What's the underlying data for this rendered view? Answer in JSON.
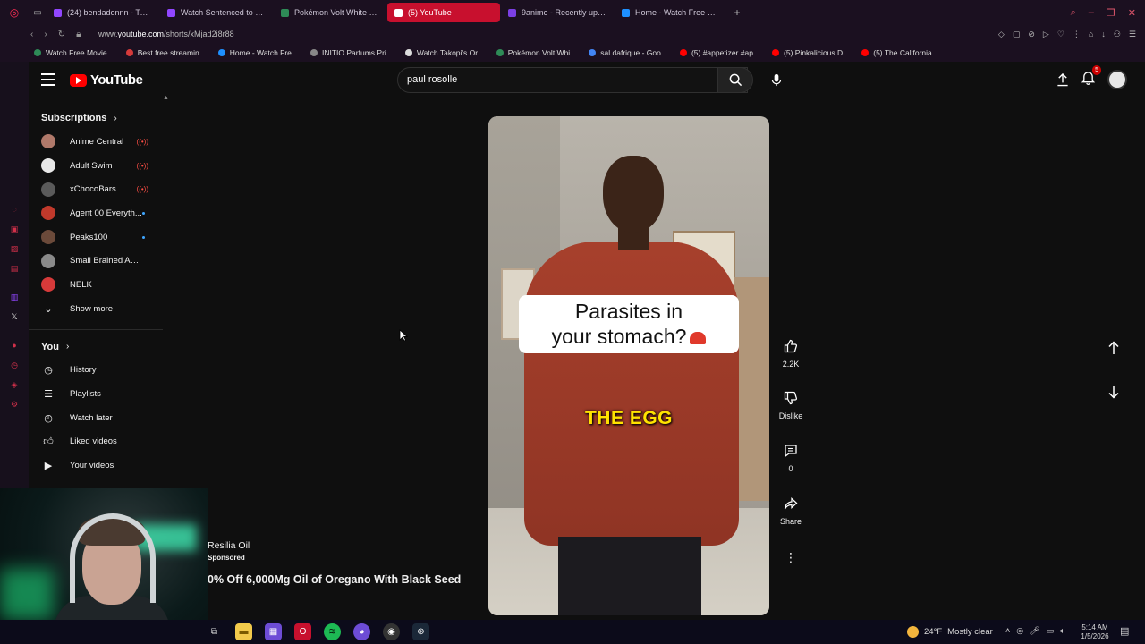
{
  "browser": {
    "tabs": [
      {
        "label": "(24) bendadonnn - Twitch",
        "color": "#9146ff"
      },
      {
        "label": "Watch Sentenced to Be a Hero",
        "color": "#9146ff"
      },
      {
        "label": "Pokémon Volt White 2 Redux",
        "color": "#2e8b57"
      },
      {
        "label": "(5) YouTube",
        "color": "#ff0000",
        "active": true
      },
      {
        "label": "9anime - Recently updated",
        "color": "#7b3fe4"
      },
      {
        "label": "Home - Watch Free Movies",
        "color": "#1e90ff"
      }
    ],
    "url_prefix": "www.",
    "url_domain": "youtube.com",
    "url_path": "/shorts/xMjad2i8r88",
    "bookmarks": [
      {
        "label": "Watch Free Movie...",
        "color": "#2e8b57"
      },
      {
        "label": "Best free streamin...",
        "color": "#d63a3a"
      },
      {
        "label": "Home - Watch Fre...",
        "color": "#1e90ff"
      },
      {
        "label": "INITIO Parfums Pri...",
        "color": "#888888"
      },
      {
        "label": "Watch Takopi's Or...",
        "color": "#dddddd"
      },
      {
        "label": "Pokémon Volt Whi...",
        "color": "#2e8b57"
      },
      {
        "label": "sal dafrique - Goo...",
        "color": "#4285f4"
      },
      {
        "label": "(5) #appetizer #ap...",
        "color": "#ff0000"
      },
      {
        "label": "(5) Pinkalicious D...",
        "color": "#ff0000"
      },
      {
        "label": "(5) The California...",
        "color": "#ff0000"
      }
    ]
  },
  "youtube": {
    "logo_text": "YouTube",
    "search_value": "paul rosolle",
    "notification_count": "5",
    "sidebar": {
      "subscriptions_label": "Subscriptions",
      "subscriptions": [
        {
          "label": "Anime Central",
          "color": "#b0796a",
          "status": "live"
        },
        {
          "label": "Adult Swim",
          "color": "#e8e8e8",
          "status": "live"
        },
        {
          "label": "xChocoBars",
          "color": "#5a5a5a",
          "status": "live"
        },
        {
          "label": "Agent 00 Everyth...",
          "color": "#c0392b",
          "status": "dot"
        },
        {
          "label": "Peaks100",
          "color": "#6b4a3a",
          "status": "dot"
        },
        {
          "label": "Small Brained Ame...",
          "color": "#8a8a8a",
          "status": "none"
        },
        {
          "label": "NELK",
          "color": "#d63a3a",
          "status": "none"
        }
      ],
      "show_more_label": "Show more",
      "you_label": "You",
      "you_items": [
        {
          "label": "History",
          "icon": "history-icon"
        },
        {
          "label": "Playlists",
          "icon": "playlists-icon"
        },
        {
          "label": "Watch later",
          "icon": "watch-later-icon"
        },
        {
          "label": "Liked videos",
          "icon": "liked-videos-icon"
        },
        {
          "label": "Your videos",
          "icon": "your-videos-icon"
        }
      ]
    },
    "short": {
      "caption_line1": "Parasites in",
      "caption_line2": "your stomach?",
      "subtitle": "THE EGG"
    },
    "actions": {
      "like_count": "2.2K",
      "dislike_label": "Dislike",
      "comment_count": "0",
      "share_label": "Share"
    },
    "ad": {
      "advertiser": "Resilia Oil",
      "sponsored_label": "Sponsored",
      "headline": "0% Off 6,000Mg Oil of Oregano With Black Seed"
    }
  },
  "taskbar": {
    "weather_temp": "24°F",
    "weather_text": "Mostly clear",
    "time": "5:14 AM",
    "date": "1/5/2026"
  }
}
